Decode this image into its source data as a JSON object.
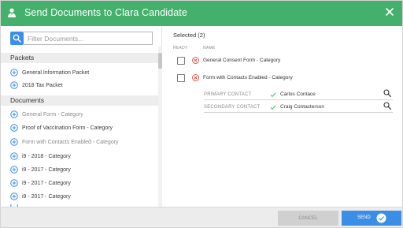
{
  "header": {
    "title": "Send Documents to Clara Candidate",
    "bg_color": "#43b06b"
  },
  "filter": {
    "placeholder": "Filter Documents..."
  },
  "packets": {
    "label": "Packets",
    "items": [
      {
        "label": "General Information Packet"
      },
      {
        "label": "2018 Tax Packet"
      }
    ]
  },
  "documents": {
    "label": "Documents",
    "items": [
      {
        "label": "General Form - Category",
        "muted": true
      },
      {
        "label": "Proof of Vaccination Form - Category",
        "muted": false
      },
      {
        "label": "Form with Contacts Enabled - Category",
        "muted": true
      },
      {
        "label": "i9 - 2018 - Category",
        "muted": false
      },
      {
        "label": "i9 - 2017 - Category",
        "muted": false
      },
      {
        "label": "i9 - 2017 - Category",
        "muted": false
      },
      {
        "label": "i9 - 2017 - Category",
        "muted": false
      }
    ]
  },
  "selected": {
    "label": "Selected (2)",
    "col_ready": "READY",
    "col_name": "NAME",
    "rows": [
      {
        "name": "General Consent Form - Category"
      },
      {
        "name": "Form with Contacts Enabled - Category"
      }
    ],
    "contacts": [
      {
        "label": "PRIMARY CONTACT",
        "value": "Carlos Contace"
      },
      {
        "label": "SECONDARY CONTACT",
        "value": "Craig Contacterson"
      }
    ]
  },
  "footer": {
    "cancel_label": "CANCEL",
    "send_label": "SEND"
  },
  "colors": {
    "accent_blue": "#3b8ee6",
    "error_red": "#d9443a",
    "check_green": "#43b06b"
  }
}
